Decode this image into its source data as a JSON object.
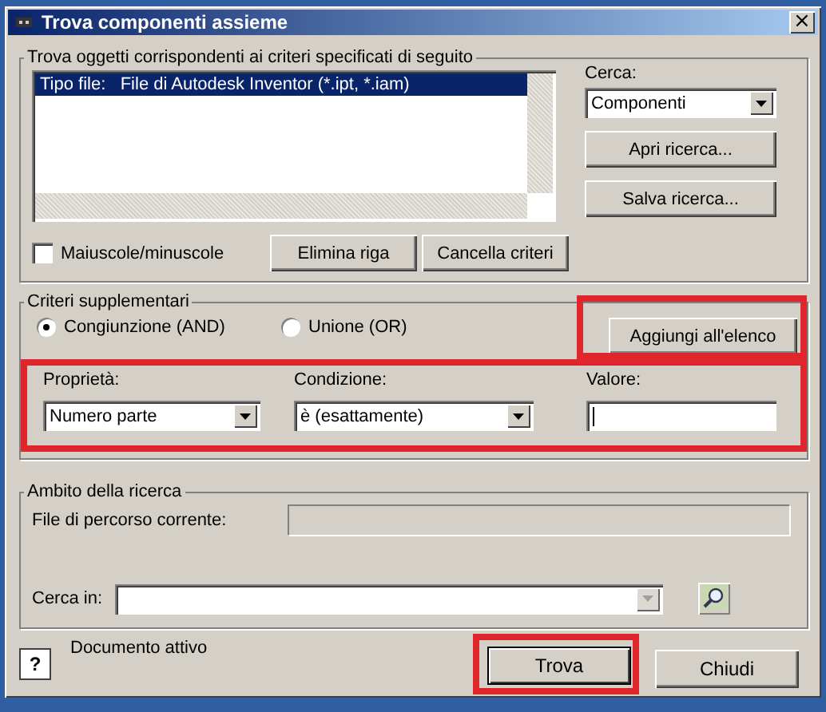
{
  "window": {
    "title": "Trova componenti assieme",
    "close": "×"
  },
  "criteria_group": {
    "legend": "Trova oggetti corrispondenti ai criteri specificati di seguito",
    "list_rows": [
      {
        "label": "Tipo file:",
        "value": "File di Autodesk Inventor (*.ipt, *.iam)",
        "selected": true
      }
    ],
    "search_label": "Cerca:",
    "search_value": "Componenti",
    "side_buttons": [
      "Apri ricerca...",
      "Salva ricerca..."
    ],
    "case_checkbox": {
      "label": "Maiuscole/minuscole",
      "checked": false
    },
    "row_buttons": [
      "Elimina riga",
      "Cancella criteri"
    ]
  },
  "extra_group": {
    "legend": "Criteri supplementari",
    "radios": [
      {
        "label": "Congiunzione (AND)",
        "selected": true
      },
      {
        "label": "Unione (OR)",
        "selected": false
      }
    ],
    "add_button": {
      "label": "Aggiungi all'elenco",
      "highlighted": true
    },
    "fields_highlighted": true,
    "property": {
      "label": "Proprietà:",
      "value": "Numero parte"
    },
    "condition": {
      "label": "Condizione:",
      "value": "è (esattamente)"
    },
    "value_field": {
      "label": "Valore:"
    }
  },
  "scope_group": {
    "legend": "Ambito della ricerca",
    "path_label": "File di percorso corrente:",
    "look_in_label": "Cerca in:"
  },
  "footer": {
    "help": "?",
    "status": "Documento attivo",
    "buttons": [
      {
        "label": "Trova",
        "highlighted": true,
        "default": true
      },
      {
        "label": "Chiudi",
        "highlighted": false,
        "default": false
      }
    ]
  }
}
